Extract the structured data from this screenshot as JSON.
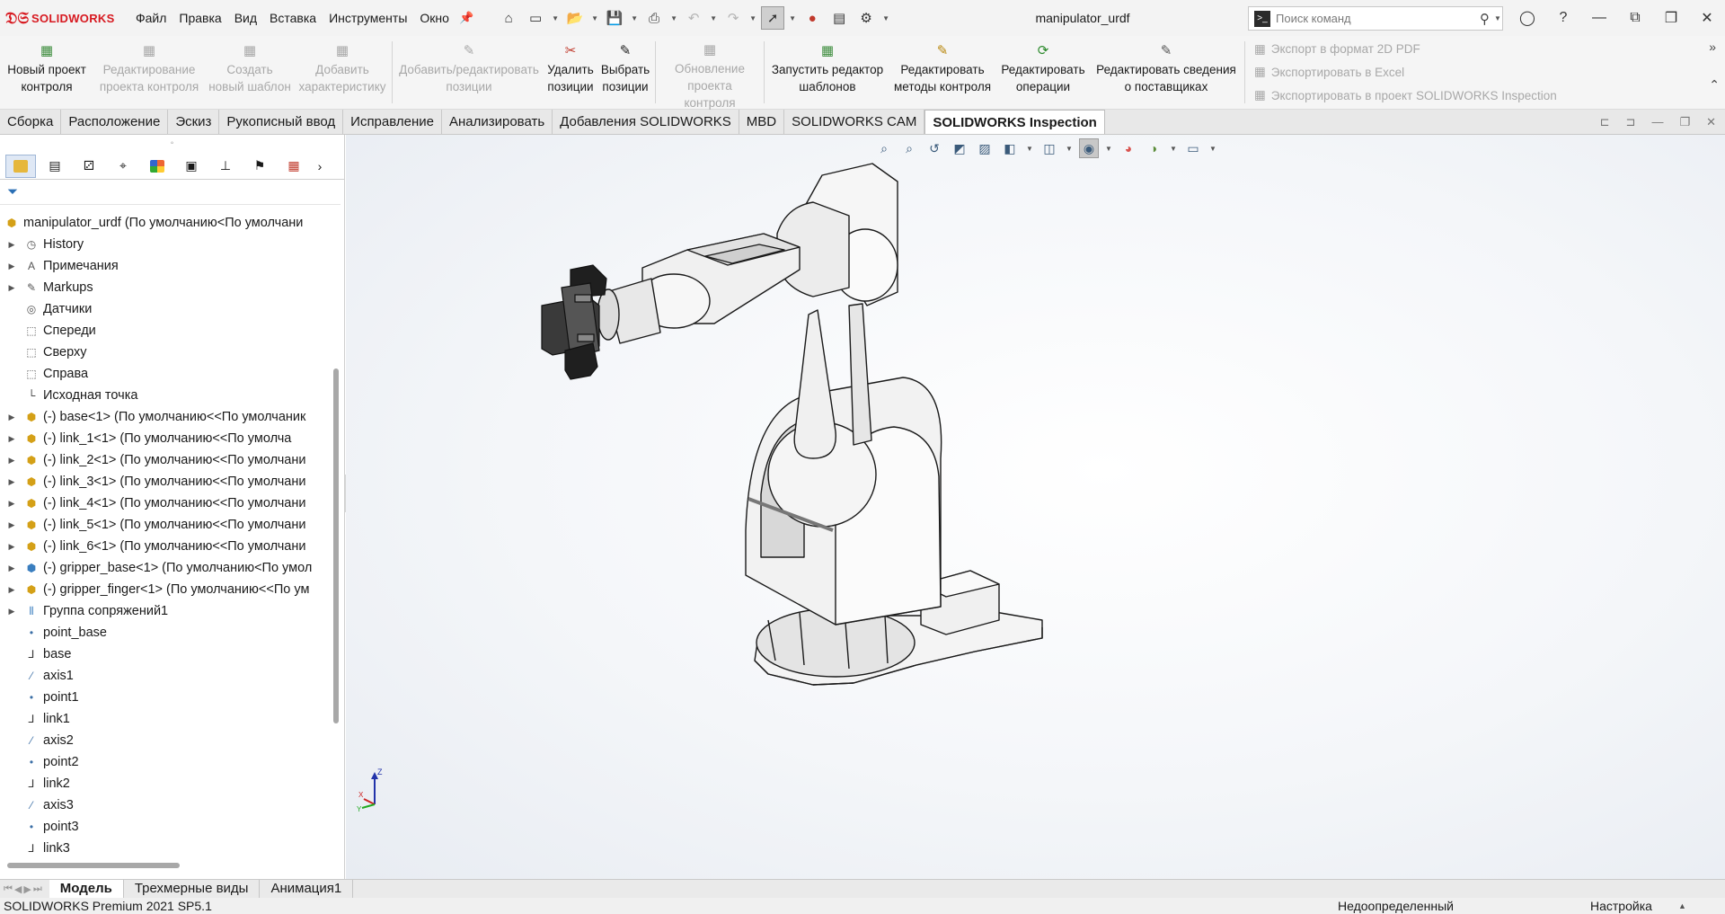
{
  "app": {
    "logo_text": "SOLIDWORKS",
    "doc_title": "manipulator_urdf"
  },
  "menu": [
    "Файл",
    "Правка",
    "Вид",
    "Вставка",
    "Инструменты",
    "Окно"
  ],
  "search": {
    "placeholder": "Поиск команд"
  },
  "ribbon": {
    "buttons": [
      {
        "line1": "Новый проект",
        "line2": "контроля",
        "enabled": true
      },
      {
        "line1": "Редактирование",
        "line2": "проекта контроля",
        "enabled": false
      },
      {
        "line1": "Создать",
        "line2": "новый шаблон",
        "enabled": false
      },
      {
        "line1": "Добавить",
        "line2": "характеристику",
        "enabled": false
      },
      {
        "line1": "Добавить/редактировать",
        "line2": "позиции",
        "enabled": false
      },
      {
        "line1": "Удалить",
        "line2": "позиции",
        "enabled": true
      },
      {
        "line1": "Выбрать",
        "line2": "позиции",
        "enabled": true
      },
      {
        "line1": "Обновление",
        "line2": "проекта контроля",
        "enabled": false
      },
      {
        "line1": "Запустить редактор",
        "line2": "шаблонов",
        "enabled": true
      },
      {
        "line1": "Редактировать",
        "line2": "методы контроля",
        "enabled": true
      },
      {
        "line1": "Редактировать",
        "line2": "операции",
        "enabled": true
      },
      {
        "line1": "Редактировать сведения",
        "line2": "о поставщиках",
        "enabled": true
      }
    ],
    "exports": [
      "Экспорт в формат 2D PDF",
      "Экспортировать в Excel",
      "Экспортировать в проект SOLIDWORKS Inspection"
    ]
  },
  "tabs": [
    "Сборка",
    "Расположение",
    "Эскиз",
    "Рукописный ввод",
    "Исправление",
    "Анализировать",
    "Добавления SOLIDWORKS",
    "MBD",
    "SOLIDWORKS CAM",
    "SOLIDWORKS Inspection"
  ],
  "active_tab": "SOLIDWORKS Inspection",
  "tree": {
    "root": "manipulator_urdf  (По умолчанию<По умолчани",
    "items": [
      {
        "label": "History",
        "expand": true,
        "icon": "history-icon"
      },
      {
        "label": "Примечания",
        "expand": true,
        "icon": "annotations-icon"
      },
      {
        "label": "Markups",
        "expand": true,
        "icon": "markups-icon"
      },
      {
        "label": "Датчики",
        "expand": false,
        "icon": "sensors-icon"
      },
      {
        "label": "Спереди",
        "expand": false,
        "icon": "plane-icon"
      },
      {
        "label": "Сверху",
        "expand": false,
        "icon": "plane-icon"
      },
      {
        "label": "Справа",
        "expand": false,
        "icon": "plane-icon"
      },
      {
        "label": "Исходная точка",
        "expand": false,
        "icon": "origin-icon"
      },
      {
        "label": "(-) base<1> (По умолчанию<<По умолчаник",
        "expand": true,
        "icon": "part-icon"
      },
      {
        "label": "(-) link_1<1> (По умолчанию<<По умолча",
        "expand": true,
        "icon": "part-icon"
      },
      {
        "label": "(-) link_2<1> (По умолчанию<<По умолчани",
        "expand": true,
        "icon": "part-icon"
      },
      {
        "label": "(-) link_3<1> (По умолчанию<<По умолчани",
        "expand": true,
        "icon": "part-icon"
      },
      {
        "label": "(-) link_4<1> (По умолчанию<<По умолчани",
        "expand": true,
        "icon": "part-icon"
      },
      {
        "label": "(-) link_5<1> (По умолчанию<<По умолчани",
        "expand": true,
        "icon": "part-icon"
      },
      {
        "label": "(-) link_6<1> (По умолчанию<<По умолчани",
        "expand": true,
        "icon": "part-icon"
      },
      {
        "label": "(-) gripper_base<1> (По умолчанию<По умол",
        "expand": true,
        "icon": "subassembly-icon"
      },
      {
        "label": "(-) gripper_finger<1> (По умолчанию<<По ум",
        "expand": true,
        "icon": "part-icon"
      },
      {
        "label": "Группа сопряжений1",
        "expand": true,
        "icon": "mates-icon"
      },
      {
        "label": "point_base",
        "expand": false,
        "icon": "point-icon"
      },
      {
        "label": "base",
        "expand": false,
        "icon": "coord-system-icon"
      },
      {
        "label": "axis1",
        "expand": false,
        "icon": "axis-icon"
      },
      {
        "label": "point1",
        "expand": false,
        "icon": "point-icon"
      },
      {
        "label": "link1",
        "expand": false,
        "icon": "coord-system-icon"
      },
      {
        "label": "axis2",
        "expand": false,
        "icon": "axis-icon"
      },
      {
        "label": "point2",
        "expand": false,
        "icon": "point-icon"
      },
      {
        "label": "link2",
        "expand": false,
        "icon": "coord-system-icon"
      },
      {
        "label": "axis3",
        "expand": false,
        "icon": "axis-icon"
      },
      {
        "label": "point3",
        "expand": false,
        "icon": "point-icon"
      },
      {
        "label": "link3",
        "expand": false,
        "icon": "coord-system-icon"
      }
    ]
  },
  "bottom_tabs": [
    "Модель",
    "Трехмерные виды",
    "Анимация1"
  ],
  "triad": {
    "z": "Z",
    "x": "X",
    "y": "Y"
  },
  "status": {
    "version": "SOLIDWORKS Premium 2021 SP5.1",
    "state": "Недоопределенный",
    "config": "Настройка"
  },
  "colors": {
    "logo": "#d71920",
    "active_tab_bg": "#ffffff",
    "viewport_bg": "#eef1f5",
    "model_fill": "#ececec",
    "gripper": "#2a2a2a"
  }
}
